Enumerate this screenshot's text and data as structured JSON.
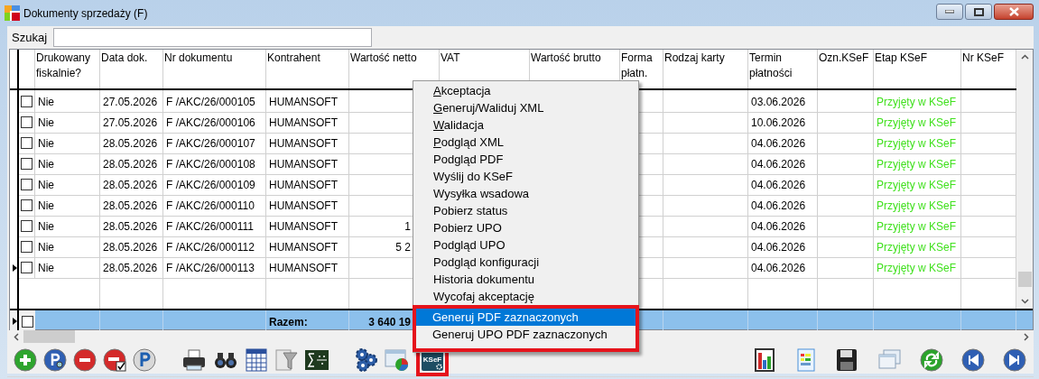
{
  "window": {
    "title": "Dokumenty sprzedaży (F)"
  },
  "search": {
    "label": "Szukaj"
  },
  "table": {
    "columns": [
      "Drukowany fiskalnie?",
      "Data dok.",
      "Nr dokumentu",
      "Kontrahent",
      "Wartość netto",
      "VAT",
      "Wartość brutto",
      "Forma płatn.",
      "Rodzaj karty",
      "Termin płatności",
      "Ozn.KSeF",
      "Etap KSeF",
      "Nr KSeF"
    ],
    "rows": [
      {
        "current": false,
        "checked": false,
        "fiscal": "Nie",
        "date": "27.05.2026",
        "number": "F /AKC/26/000105",
        "contractor": "HUMANSOFT",
        "due": "03.06.2026",
        "stage": "Przyjęty w KSeF"
      },
      {
        "current": false,
        "checked": false,
        "fiscal": "Nie",
        "date": "27.05.2026",
        "number": "F /AKC/26/000106",
        "contractor": "HUMANSOFT",
        "due": "10.06.2026",
        "stage": "Przyjęty w KSeF"
      },
      {
        "current": false,
        "checked": false,
        "fiscal": "Nie",
        "date": "28.05.2026",
        "number": "F /AKC/26/000107",
        "contractor": "HUMANSOFT",
        "due": "04.06.2026",
        "stage": "Przyjęty w KSeF"
      },
      {
        "current": false,
        "checked": false,
        "fiscal": "Nie",
        "date": "28.05.2026",
        "number": "F /AKC/26/000108",
        "contractor": "HUMANSOFT",
        "due": "04.06.2026",
        "stage": "Przyjęty w KSeF"
      },
      {
        "current": false,
        "checked": false,
        "fiscal": "Nie",
        "date": "28.05.2026",
        "number": "F /AKC/26/000109",
        "contractor": "HUMANSOFT",
        "due": "04.06.2026",
        "stage": "Przyjęty w KSeF"
      },
      {
        "current": false,
        "checked": false,
        "fiscal": "Nie",
        "date": "28.05.2026",
        "number": "F /AKC/26/000110",
        "contractor": "HUMANSOFT",
        "due": "04.06.2026",
        "stage": "Przyjęty w KSeF"
      },
      {
        "current": false,
        "checked": false,
        "fiscal": "Nie",
        "date": "28.05.2026",
        "number": "F /AKC/26/000111",
        "contractor": "HUMANSOFT",
        "netto": "1",
        "due": "04.06.2026",
        "stage": "Przyjęty w KSeF"
      },
      {
        "current": false,
        "checked": false,
        "fiscal": "Nie",
        "date": "28.05.2026",
        "number": "F /AKC/26/000112",
        "contractor": "HUMANSOFT",
        "netto": "5 2",
        "due": "04.06.2026",
        "stage": "Przyjęty w KSeF"
      },
      {
        "current": true,
        "checked": false,
        "fiscal": "Nie",
        "date": "28.05.2026",
        "number": "F /AKC/26/000113",
        "contractor": "HUMANSOFT",
        "due": "04.06.2026",
        "stage": "Przyjęty w KSeF"
      }
    ],
    "footer": {
      "current": true,
      "checked": false,
      "label": "Razem:",
      "netto": "3 640 19"
    }
  },
  "context_menu": [
    {
      "label": "Akceptacja",
      "mnemonic": true,
      "selected": false,
      "outlined": false
    },
    {
      "label": "Generuj/Waliduj XML",
      "mnemonic": true,
      "selected": false,
      "outlined": false
    },
    {
      "label": "Walidacja",
      "mnemonic": true,
      "selected": false,
      "outlined": false
    },
    {
      "label": "Podgląd XML",
      "mnemonic": true,
      "selected": false,
      "outlined": false
    },
    {
      "label": "Podgląd PDF",
      "mnemonic": false,
      "selected": false,
      "outlined": false
    },
    {
      "label": "Wyślij do KSeF",
      "mnemonic": false,
      "selected": false,
      "outlined": false
    },
    {
      "label": "Wysyłka wsadowa",
      "mnemonic": false,
      "selected": false,
      "outlined": false
    },
    {
      "label": "Pobierz status",
      "mnemonic": false,
      "selected": false,
      "outlined": false
    },
    {
      "label": "Pobierz UPO",
      "mnemonic": false,
      "selected": false,
      "outlined": false
    },
    {
      "label": "Podgląd UPO",
      "mnemonic": false,
      "selected": false,
      "outlined": false
    },
    {
      "label": "Podgląd konfiguracji",
      "mnemonic": false,
      "selected": false,
      "outlined": false
    },
    {
      "label": "Historia dokumentu",
      "mnemonic": false,
      "selected": false,
      "outlined": false
    },
    {
      "label": "Wycofaj akceptację",
      "mnemonic": false,
      "selected": false,
      "outlined": false
    },
    {
      "label": "Generuj PDF zaznaczonych",
      "mnemonic": false,
      "selected": true,
      "outlined": true
    },
    {
      "label": "Generuj UPO PDF zaznaczonych",
      "mnemonic": false,
      "selected": false,
      "outlined": true
    }
  ],
  "toolbar_left": [
    {
      "kind": "add"
    },
    {
      "kind": "preview"
    },
    {
      "kind": "delete"
    },
    {
      "kind": "delete-check"
    },
    {
      "kind": "p"
    },
    {
      "kind": "gap"
    },
    {
      "kind": "printer"
    },
    {
      "kind": "binoculars"
    },
    {
      "kind": "calendar"
    },
    {
      "kind": "filter"
    },
    {
      "kind": "sigma"
    },
    {
      "kind": "gap"
    },
    {
      "kind": "gears"
    },
    {
      "kind": "window-chart"
    },
    {
      "kind": "ksef",
      "label": "KSeF",
      "outlined": true
    }
  ],
  "toolbar_right": [
    {
      "kind": "chart"
    },
    {
      "kind": "sheet"
    },
    {
      "kind": "save"
    },
    {
      "kind": "windows"
    },
    {
      "kind": "refresh"
    },
    {
      "kind": "prev"
    },
    {
      "kind": "next"
    }
  ]
}
